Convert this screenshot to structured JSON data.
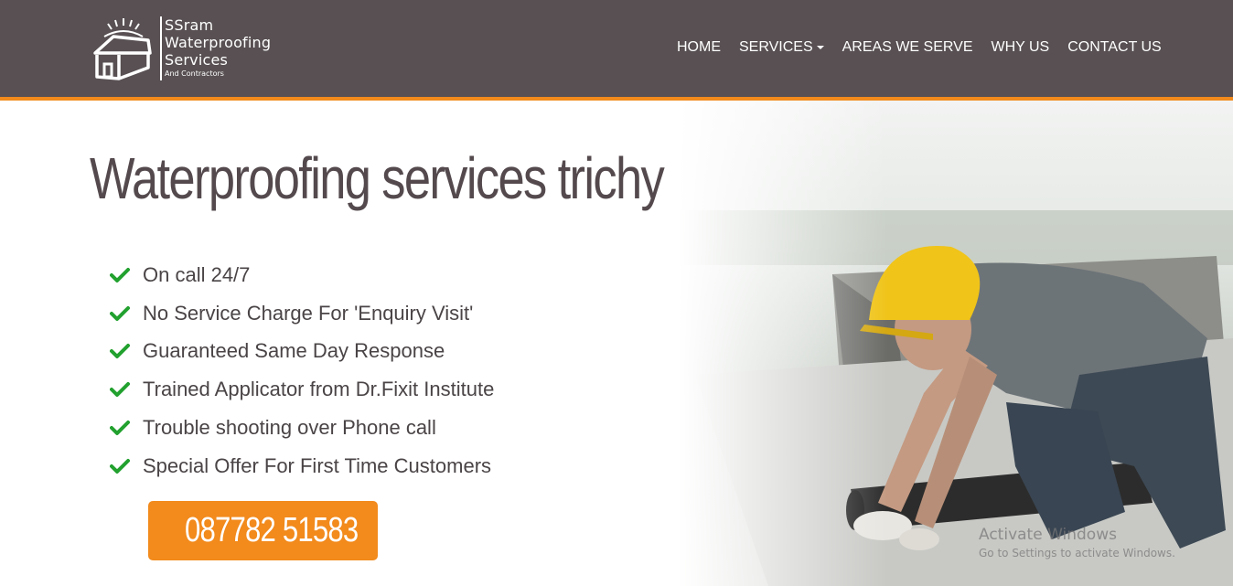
{
  "colors": {
    "header_bg": "#585052",
    "accent": "#f28a1c",
    "check": "#22a12f",
    "title": "#544a4d"
  },
  "header": {
    "logo": {
      "line1": "SSram",
      "line2": "Waterproofing",
      "line3": "Services",
      "tagline": "And Contractors",
      "icon": "house-logo-icon"
    },
    "nav": {
      "home": "HOME",
      "services": "SERVICES",
      "areas": "AREAS WE SERVE",
      "why": "WHY US",
      "contact": "CONTACT US"
    }
  },
  "hero": {
    "title": "Waterproofing services trichy",
    "features": [
      "On call 24/7",
      "No Service Charge For 'Enquiry Visit'",
      "Guaranteed Same Day Response",
      "Trained Applicator from Dr.Fixit Institute",
      "Trouble shooting over Phone call",
      "Special Offer For First Time Customers"
    ],
    "check_icon": "check-icon",
    "phone_icon": "phone-icon",
    "phone": "087782 51583"
  },
  "watermark": {
    "title": "Activate Windows",
    "subtitle": "Go to Settings to activate Windows."
  }
}
